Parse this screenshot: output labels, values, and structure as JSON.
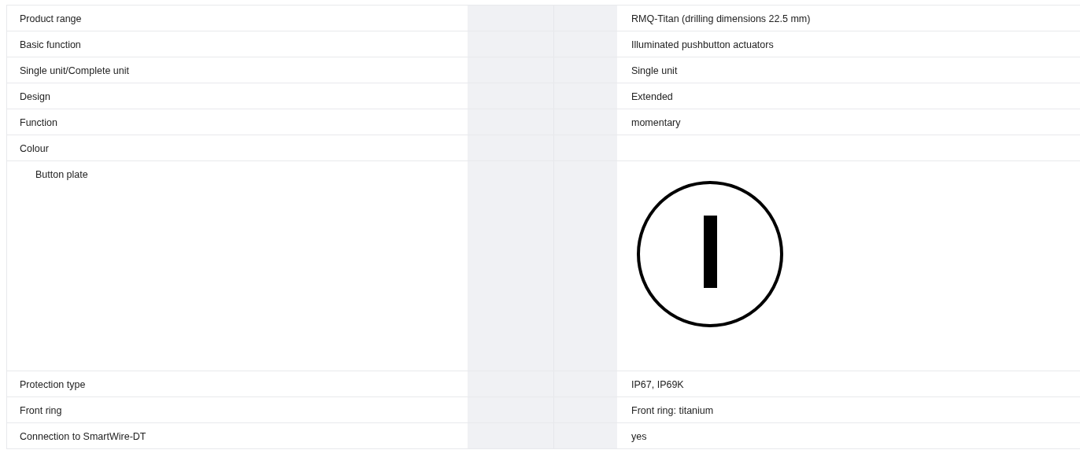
{
  "rows": [
    {
      "label": "Product range",
      "kind": "text",
      "value": "RMQ-Titan (drilling dimensions 22.5 mm)"
    },
    {
      "label": "Basic function",
      "kind": "text",
      "value": "Illuminated pushbutton actuators"
    },
    {
      "label": "Single unit/Complete unit",
      "kind": "text",
      "value": "Single unit"
    },
    {
      "label": "Design",
      "kind": "text",
      "value": "Extended"
    },
    {
      "label": "Function",
      "kind": "text",
      "value": "momentary"
    },
    {
      "label": "Colour",
      "kind": "empty",
      "children": [
        {
          "label": "Button plate",
          "kind": "symbol"
        }
      ]
    },
    {
      "label": "Protection type",
      "kind": "text",
      "value": "IP67, IP69K"
    },
    {
      "label": "Front ring",
      "kind": "text",
      "value": "Front ring: titanium"
    },
    {
      "label": "Connection to SmartWire-DT",
      "kind": "text",
      "value": "yes"
    }
  ]
}
